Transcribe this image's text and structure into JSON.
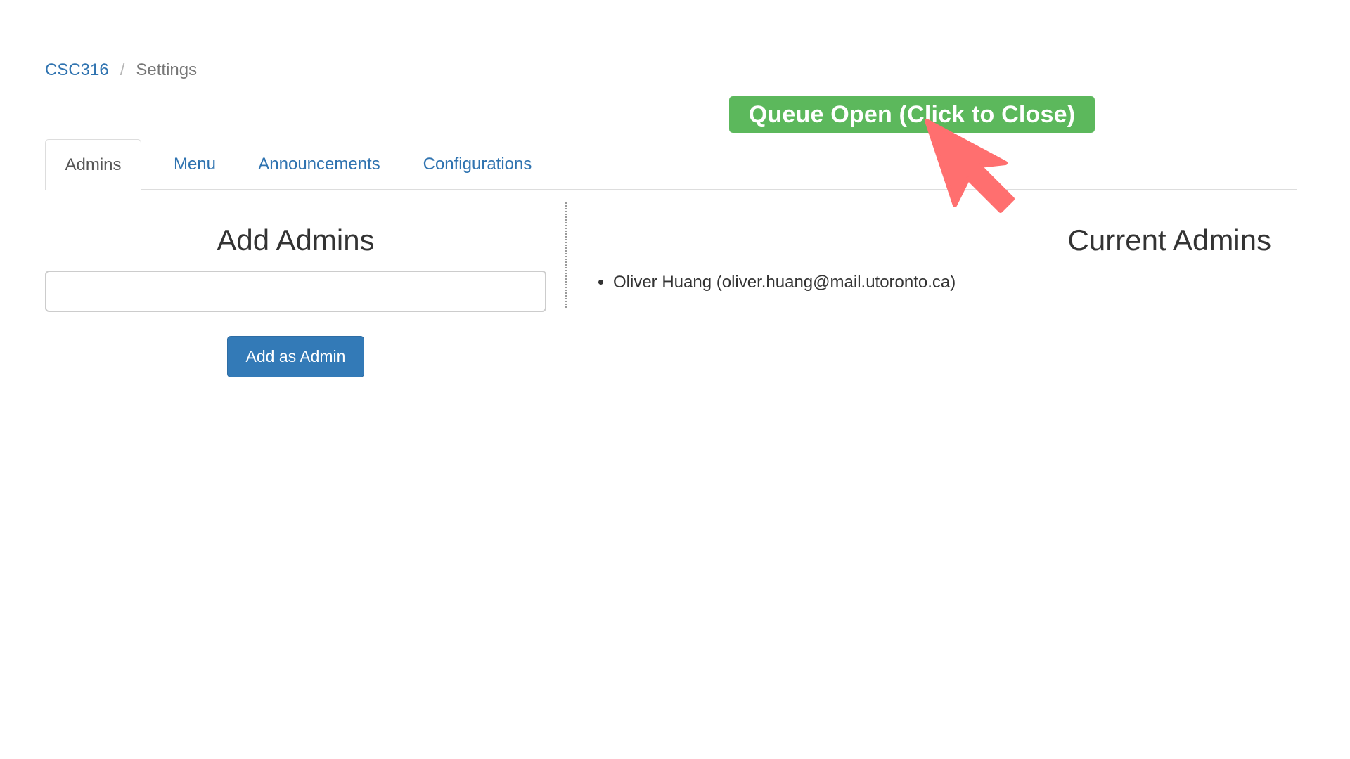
{
  "breadcrumb": {
    "course": "CSC316",
    "separator": "/",
    "current": "Settings"
  },
  "queue_toggle": {
    "label": "Queue Open (Click to Close)",
    "color": "#5cb85c"
  },
  "tabs": [
    {
      "label": "Admins",
      "active": true
    },
    {
      "label": "Menu",
      "active": false
    },
    {
      "label": "Announcements",
      "active": false
    },
    {
      "label": "Configurations",
      "active": false
    }
  ],
  "add_admins": {
    "heading": "Add Admins",
    "input_value": "",
    "button_label": "Add as Admin",
    "button_color": "#337ab7"
  },
  "current_admins": {
    "heading": "Current Admins",
    "items": [
      "Oliver Huang (oliver.huang@mail.utoronto.ca)"
    ]
  },
  "overlay": {
    "pointer_icon": "arrow-pointer-icon",
    "pointer_color": "#ff6f6f"
  }
}
